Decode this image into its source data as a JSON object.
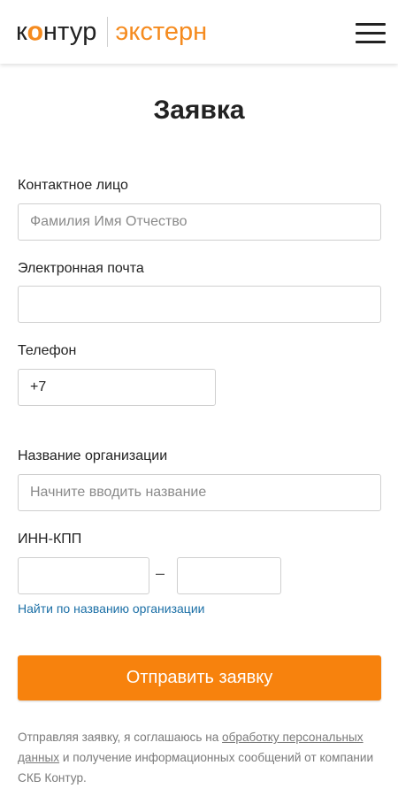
{
  "header": {
    "logo_brand_left": "к",
    "logo_brand_ring": "о",
    "logo_brand_right": "нтур",
    "logo_product": "экстерн",
    "menu_icon": "hamburger-menu-icon",
    "colors": {
      "brand_orange": "#f58b1f",
      "text": "#222222"
    }
  },
  "form": {
    "title": "Заявка",
    "contact": {
      "label": "Контактное лицо",
      "placeholder": "Фамилия Имя Отчество",
      "value": ""
    },
    "email": {
      "label": "Электронная почта",
      "placeholder": "",
      "value": ""
    },
    "phone": {
      "label": "Телефон",
      "value": "+7"
    },
    "org": {
      "label": "Название организации",
      "placeholder": "Начните вводить название",
      "value": ""
    },
    "inn_kpp": {
      "label": "ИНН-КПП",
      "separator": "–",
      "inn_value": "",
      "kpp_value": ""
    },
    "find_link": "Найти по названию организации",
    "submit_label": "Отправить заявку",
    "submit_color": "#f7820d",
    "consent": {
      "text_before": "Отправляя заявку, я соглашаюсь на ",
      "link_text": "обработку персональных данных",
      "text_after": " и получение информационных сообщений от компании СКБ Контур."
    }
  }
}
